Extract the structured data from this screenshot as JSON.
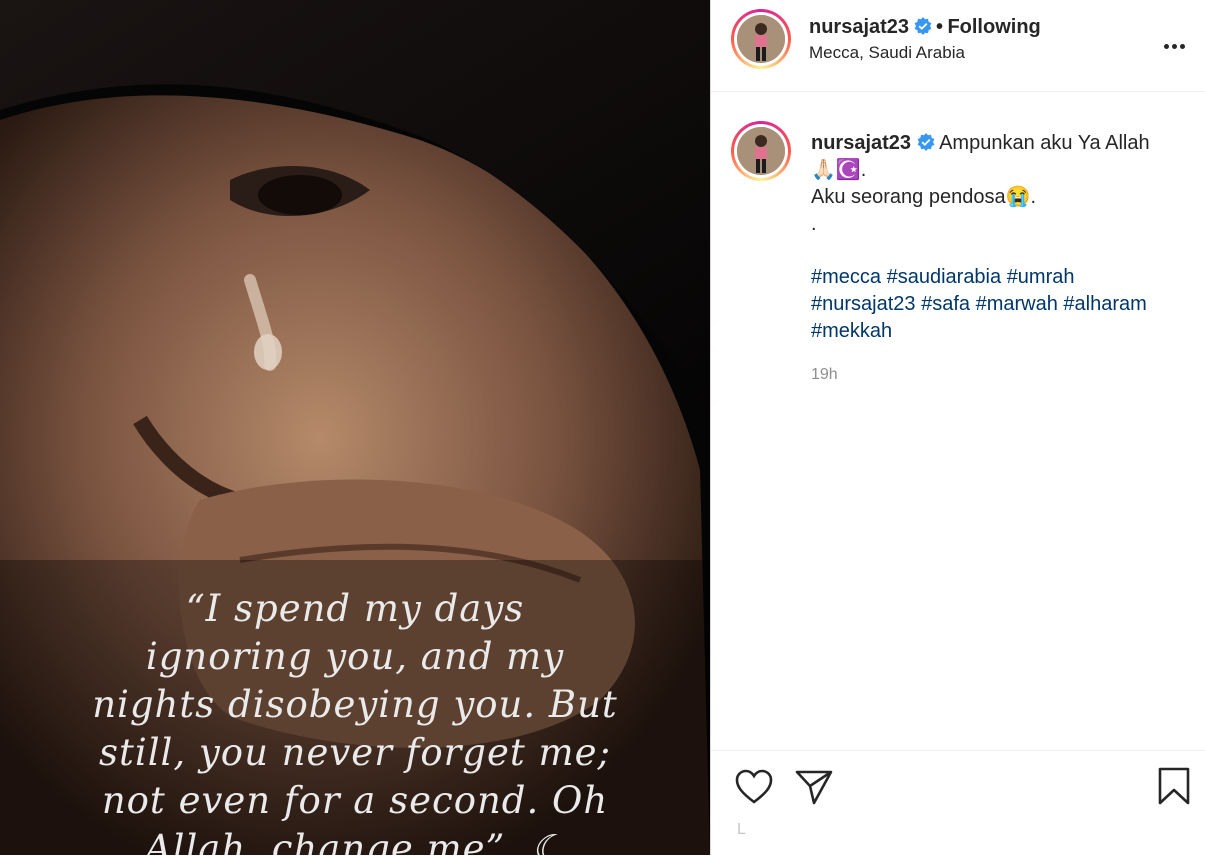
{
  "post": {
    "username": "nursajat23",
    "follow_separator": "•",
    "follow_status": "Following",
    "location": "Mecca, Saudi Arabia",
    "caption_line1": "Ampunkan aku Ya Allah",
    "caption_line2_emojis": "🙏🏻☪️.",
    "caption_line3": "Aku seorang pendosa😭.",
    "caption_dot": ".",
    "hashtags": [
      "#mecca",
      "#saudiarabia",
      "#umrah",
      "#nursajat23",
      "#safa",
      "#marwah",
      "#alharam",
      "#mekkah"
    ],
    "time": "19h",
    "likes_partial": "L"
  },
  "image_quote": {
    "lines": [
      "“I spend my days",
      "ignoring you, and my",
      "nights disobeying you. But",
      "still, you never forget me;",
      "not even for a second. Oh",
      "Allah, change me”. ☾"
    ]
  },
  "colors": {
    "verified": "#3897f0",
    "hashtag": "#00376b",
    "text": "#262626",
    "muted": "#8e8e8e"
  },
  "icons": {
    "like": "heart-icon",
    "share": "paper-plane-icon",
    "save": "bookmark-icon",
    "more": "more-options-icon",
    "verified": "verified-badge-icon"
  }
}
